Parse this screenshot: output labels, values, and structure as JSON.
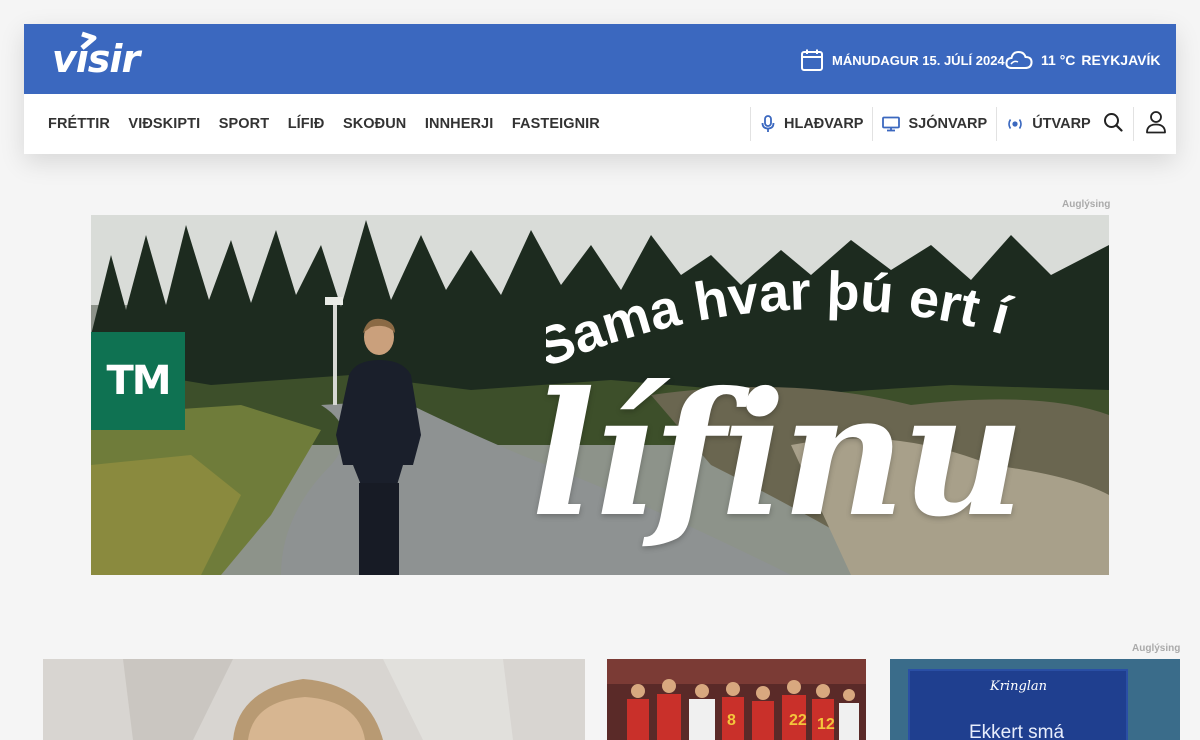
{
  "brand": {
    "logo_text": "vísir",
    "header_color": "#3b68bf"
  },
  "topbar": {
    "date": "MÁNUDAGUR 15. JÚLÍ 2024",
    "date_icon": "calendar-icon",
    "temperature": "11 °C",
    "location": "REYKJAVÍK",
    "weather_icon": "cloud-icon"
  },
  "nav": {
    "main_items": [
      {
        "label": "FRÉTTIR"
      },
      {
        "label": "VIÐSKIPTI"
      },
      {
        "label": "SPORT"
      },
      {
        "label": "LÍFIÐ"
      },
      {
        "label": "SKOÐUN"
      },
      {
        "label": "INNHERJI"
      },
      {
        "label": "FASTEIGNIR"
      }
    ],
    "media_items": [
      {
        "label": "HLAÐVARP",
        "icon": "microphone-icon"
      },
      {
        "label": "SJÓNVARP",
        "icon": "monitor-icon"
      },
      {
        "label": "ÚTVARP",
        "icon": "radio-icon"
      }
    ],
    "tools": {
      "search_icon": "search-icon",
      "user_icon": "user-icon"
    }
  },
  "ads": {
    "label": "Auglýsing",
    "banner": {
      "brand_mark": "TM",
      "brand_color": "#0f7252",
      "slogan_top": "Sama hvar þú ert í",
      "slogan_big": "lífinu"
    },
    "side_label": "Auglýsing"
  },
  "teasers": {
    "third": {
      "brand": "Kringlan",
      "text": "Ekkert smá"
    }
  }
}
